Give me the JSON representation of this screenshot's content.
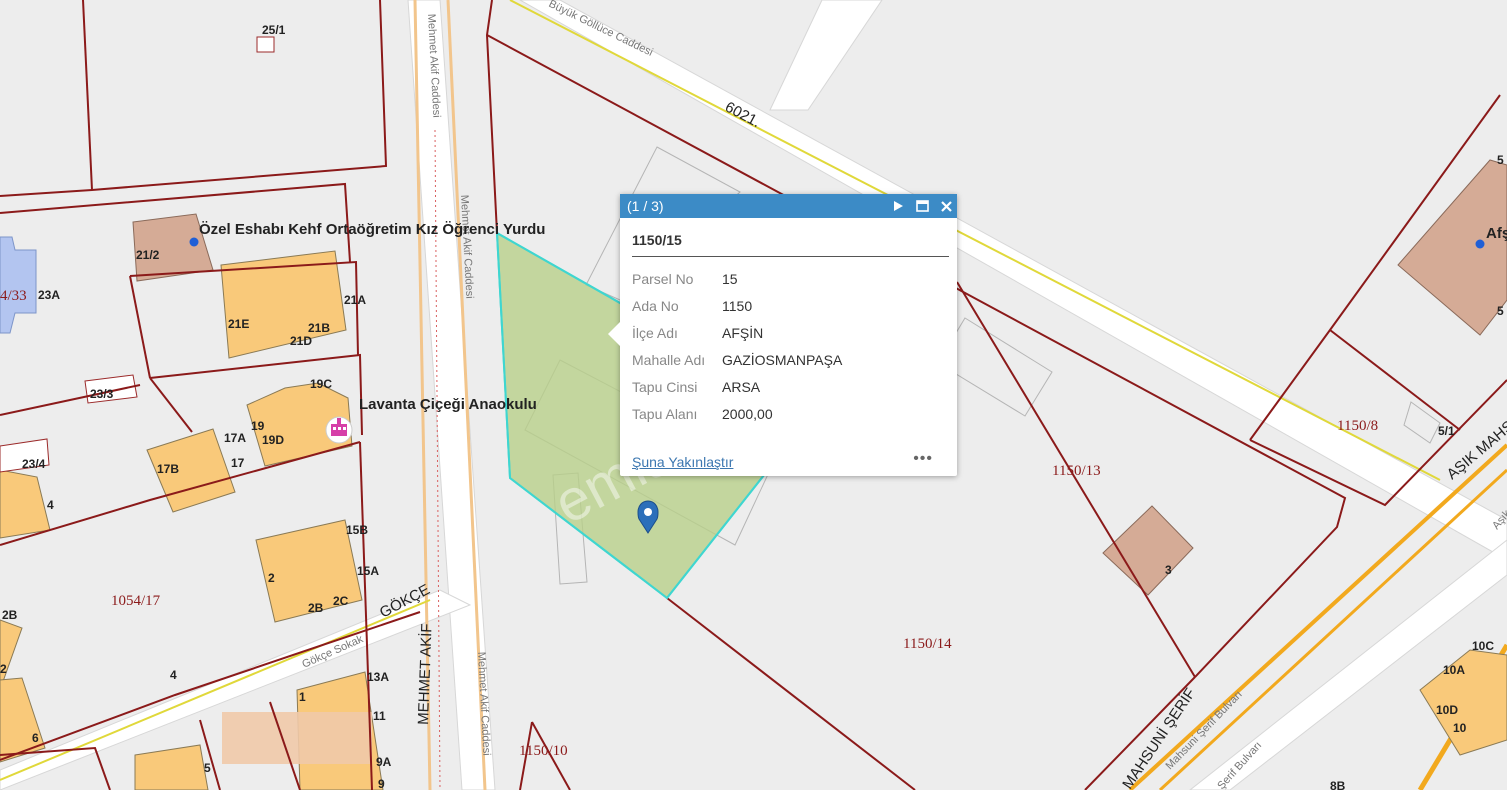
{
  "map": {
    "streets": {
      "buyuk_gollluce": "Büyük Göllüce Caddesi",
      "road_6021": "6021.",
      "mehmet_akif_1": "Mehmet Akif Caddesi",
      "mehmet_akif_2": "Mehmet Akif Caddesi",
      "mehmet_akif_3": "Mehmet Akif Caddesi",
      "mehmet_akif_caps": "MEHMET AKİF",
      "gokce_caps": "GÖKÇE",
      "gokce_sokak": "Gökçe Sokak",
      "asik_mahsuni_caps": "AŞIK MAHSU",
      "mahsuni_serif_caps": "MAHSUNİ ŞERİF",
      "serif_bulvari_1": "Mahsuni Şerif Bulvarı",
      "serif_bulvari_2": "Aşık Mahsuni Şerif Bulvarı",
      "serif_bulvari_3": "Şerif Bulvarı"
    },
    "parcels": {
      "p1054_17": "1054/17",
      "p1150_13": "1150/13",
      "p1150_14": "1150/14",
      "p1150_8": "1150/8",
      "p1150_10": "1150/10",
      "p4_33": "4/33"
    },
    "buildings": {
      "b25_1": "25/1",
      "b21_2": "21/2",
      "b23A": "23A",
      "b21A": "21A",
      "b21E": "21E",
      "b21B": "21B",
      "b21D": "21D",
      "b23_3": "23/3",
      "b19C": "19C",
      "b19": "19",
      "b19D": "19D",
      "b17A": "17A",
      "b17B": "17B",
      "b17": "17",
      "b23_4": "23/4",
      "b4": "4",
      "b15B": "15B",
      "b15A": "15A",
      "b2": "2",
      "b2B": "2B",
      "b2C": "2C",
      "b2B_left": "2B",
      "b2_left": "2",
      "b6": "6",
      "b4_road": "4",
      "b13A": "13A",
      "b1": "1",
      "b11": "11",
      "b9A": "9A",
      "b9": "9",
      "b5": "5",
      "b3": "3",
      "b5_1": "5/1",
      "b5_top": "5",
      "b5_right": "5",
      "b10C": "10C",
      "b10A": "10A",
      "b10D": "10D",
      "b10": "10",
      "b8B": "8B"
    },
    "pois": {
      "yurt": "Özel Eshabı Kehf Ortaöğretim Kız Öğrenci Yurdu",
      "anaokulu": "Lavanta Çiçeği Anaokulu",
      "afsin": "Afş"
    },
    "watermark": "emlak"
  },
  "popup": {
    "counter": "(1 / 3)",
    "title": "1150/15",
    "rows": [
      {
        "key": "Parsel No",
        "value": "15"
      },
      {
        "key": "Ada No",
        "value": "1150"
      },
      {
        "key": "İlçe Adı",
        "value": "AFŞİN"
      },
      {
        "key": "Mahalle Adı",
        "value": "GAZİOSMANPAŞA"
      },
      {
        "key": "Tapu Cinsi",
        "value": "ARSA"
      },
      {
        "key": "Tapu Alanı",
        "value": "2000,00"
      }
    ],
    "zoom_link": "Şuna Yakınlaştır",
    "more": "•••",
    "icons": {
      "next": "play-icon",
      "maximize": "maximize-icon",
      "close": "close-icon"
    }
  },
  "colors": {
    "parcel_line": "#8b1a1a",
    "building_fill": "#f9c97a",
    "building_brown": "#d5ab96",
    "selection_fill": "#b8d08a",
    "selection_line": "#3fd6d0",
    "popup_header": "#3c8bc6",
    "road_orange": "#f2a91e"
  }
}
